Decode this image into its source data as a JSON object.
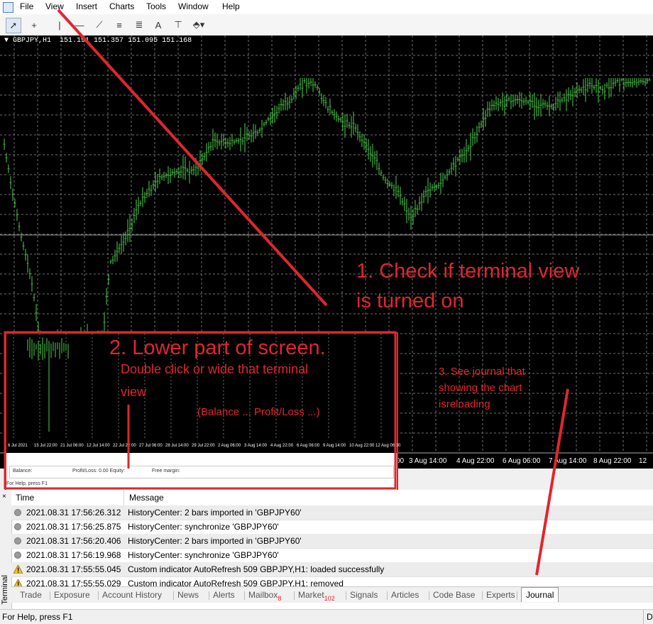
{
  "menu": [
    "File",
    "View",
    "Insert",
    "Charts",
    "Tools",
    "Window",
    "Help"
  ],
  "toolbar": {
    "icons": [
      "cursor-icon",
      "crosshair-icon",
      "vertical-line-icon",
      "horizontal-line-icon",
      "trendline-icon",
      "equidistant-channel-icon",
      "fibonacci-icon",
      "text-icon",
      "text-label-icon",
      "shapes-icon"
    ]
  },
  "chart": {
    "symbol": "GBPJPY,H1",
    "quotes": "151.191 151.357 151.095 151.168",
    "x_labels": [
      "00",
      "3 Aug 14:00",
      "4 Aug 22:00",
      "6 Aug 06:00",
      "7 Aug 14:00",
      "8 Aug 22:00",
      "10 Aug 22:00",
      "12"
    ],
    "colors": {
      "background": "#000000",
      "candles": "#3fae3f",
      "grid": "#6f6f6f"
    }
  },
  "annotations": {
    "note1_line1": "1. Check if terminal view",
    "note1_line2": "is turned on",
    "note2_title": "2. Lower part of screen.",
    "note2_line1": "Double click or wide that terminal",
    "note2_line2": "view",
    "note2_line3": "(Balance ... Profit/Loss ...)",
    "note3_line1": "3. See journal that",
    "note3_line2": "showing the chart",
    "note3_line3": "isreloading",
    "color": "#e0262e"
  },
  "inset": {
    "x_labels": [
      "6 Jul 2021",
      "15 Jul 22:00",
      "21 Jul 06:00",
      "12 Jul 14:00",
      "22 Jul 22:00",
      "27 Jul 06:00",
      "28 Jul 14:00",
      "29 Jul 22:00",
      "2 Aug 06:00",
      "3 Aug 14:00",
      "4 Aug 22:00",
      "6 Aug 06:00",
      "9 Aug 14:00",
      "10 Aug 22:00",
      "12 Aug 06:00"
    ],
    "balance": "Balance:",
    "profit": "Profit/Loss: 0.00  Equity:",
    "free_margin": "Free margin:",
    "status": "For Help, press F1"
  },
  "terminal": {
    "side_label": "Terminal",
    "columns": [
      "Time",
      "Message"
    ],
    "rows": [
      {
        "icon": "info",
        "time": "2021.08.31 17:56:26.312",
        "message": "HistoryCenter: 2 bars imported in 'GBPJPY60'"
      },
      {
        "icon": "info",
        "time": "2021.08.31 17:56:25.875",
        "message": "HistoryCenter: synchronize 'GBPJPY60'"
      },
      {
        "icon": "info",
        "time": "2021.08.31 17:56:20.406",
        "message": "HistoryCenter: 2 bars imported in 'GBPJPY60'"
      },
      {
        "icon": "info",
        "time": "2021.08.31 17:56:19.968",
        "message": "HistoryCenter: synchronize 'GBPJPY60'"
      },
      {
        "icon": "warning",
        "time": "2021.08.31 17:55:55.045",
        "message": "Custom indicator AutoRefresh 509 GBPJPY,H1: loaded successfully"
      },
      {
        "icon": "warning",
        "time": "2021.08.31 17:55:55.029",
        "message": "Custom indicator AutoRefresh 509 GBPJPY,H1: removed"
      }
    ],
    "tabs": [
      {
        "label": "Trade",
        "badge": ""
      },
      {
        "label": "Exposure",
        "badge": ""
      },
      {
        "label": "Account History",
        "badge": ""
      },
      {
        "label": "News",
        "badge": ""
      },
      {
        "label": "Alerts",
        "badge": ""
      },
      {
        "label": "Mailbox",
        "badge": "8"
      },
      {
        "label": "Market",
        "badge": "102"
      },
      {
        "label": "Signals",
        "badge": ""
      },
      {
        "label": "Articles",
        "badge": ""
      },
      {
        "label": "Code Base",
        "badge": ""
      },
      {
        "label": "Experts",
        "badge": ""
      },
      {
        "label": "Journal",
        "badge": ""
      }
    ],
    "active_tab": "Journal"
  },
  "statusbar": {
    "text": "For Help, press F1",
    "right": "D"
  }
}
